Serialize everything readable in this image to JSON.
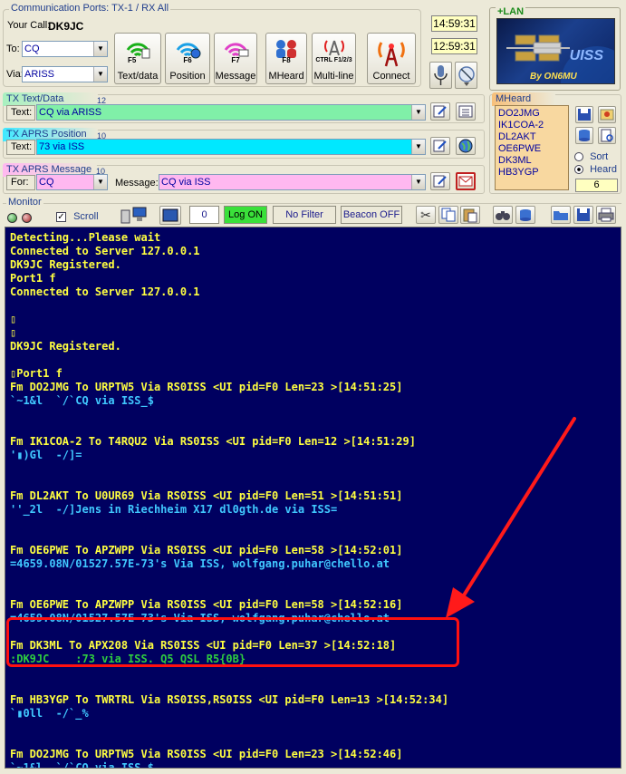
{
  "comm_ports": {
    "title": "Communication Ports: TX-1 / RX All",
    "your_call_label": "Your Call:",
    "your_call": "DK9JC",
    "to_label": "To:",
    "to_value": "CQ",
    "via_label": "Via:",
    "via_value": "ARISS"
  },
  "buttons": {
    "text_data": {
      "key": "F5",
      "label": "Text/data"
    },
    "position": {
      "key": "F6",
      "label": "Position"
    },
    "message": {
      "key": "F7",
      "label": "Message"
    },
    "mheard": {
      "key": "F8",
      "label": "MHeard"
    },
    "multiline": {
      "key": "CTRL F1/2/3",
      "label": "Multi-line"
    },
    "connect": {
      "label": "Connect"
    }
  },
  "clock": {
    "time1": "14:59:31",
    "time2": "12:59:31"
  },
  "lan": {
    "title": "+LAN",
    "logo_text": "UISS",
    "logo_sub": "By ON6MU"
  },
  "tx_text": {
    "title": "TX Text/Data",
    "count": "12",
    "label": "Text:",
    "value": "CQ via ARISS"
  },
  "tx_aprs_pos": {
    "title": "TX APRS Position",
    "count": "10",
    "label": "Text:",
    "value": "73 via ISS"
  },
  "tx_aprs_msg": {
    "title": "TX APRS Message",
    "count": "10",
    "for_label": "For:",
    "for_value": "CQ",
    "msg_label": "Message:",
    "msg_value": "CQ via ISS"
  },
  "mheard": {
    "title": "MHeard",
    "items": [
      "DO2JMG",
      "IK1COA-2",
      "DL2AKT",
      "OE6PWE",
      "DK3ML",
      "HB3YGP"
    ],
    "sort_label": "Sort",
    "heard_label": "Heard",
    "count": "6"
  },
  "monitor": {
    "title": "Monitor",
    "scroll_label": "Scroll",
    "counter": "0",
    "log_btn": "Log ON",
    "filter_btn": "No Filter",
    "beacon_btn": "Beacon OFF",
    "lines": [
      {
        "t": "Detecting...Please wait",
        "c": "yellow"
      },
      {
        "t": "Connected to Server 127.0.0.1",
        "c": "yellow"
      },
      {
        "t": "DK9JC Registered.",
        "c": "yellow"
      },
      {
        "t": "Port1 f",
        "c": "yellow"
      },
      {
        "t": "Connected to Server 127.0.0.1",
        "c": "yellow"
      },
      {
        "t": "",
        "c": "yellow"
      },
      {
        "t": "▯",
        "c": "yellow"
      },
      {
        "t": "▯",
        "c": "yellow"
      },
      {
        "t": "DK9JC Registered.",
        "c": "yellow"
      },
      {
        "t": "",
        "c": "yellow"
      },
      {
        "t": "▯Port1 f",
        "c": "yellow"
      },
      {
        "t": "Fm DO2JMG To URPTW5 Via RS0ISS <UI pid=F0 Len=23 >[14:51:25]",
        "c": "yellow"
      },
      {
        "t": "`~1&l  `/`CQ via ISS_$",
        "c": "cyan"
      },
      {
        "t": "",
        "c": "yellow"
      },
      {
        "t": "",
        "c": "yellow"
      },
      {
        "t": "Fm IK1COA-2 To T4RQU2 Via RS0ISS <UI pid=F0 Len=12 >[14:51:29]",
        "c": "yellow"
      },
      {
        "t": "'▮)Gl  -/]=",
        "c": "cyan"
      },
      {
        "t": "",
        "c": "yellow"
      },
      {
        "t": "",
        "c": "yellow"
      },
      {
        "t": "Fm DL2AKT To U0UR69 Via RS0ISS <UI pid=F0 Len=51 >[14:51:51]",
        "c": "yellow"
      },
      {
        "t": "''_2l  -/]Jens in Riechheim X17 dl0gth.de via ISS=",
        "c": "cyan"
      },
      {
        "t": "",
        "c": "yellow"
      },
      {
        "t": "",
        "c": "yellow"
      },
      {
        "t": "Fm OE6PWE To APZWPP Via RS0ISS <UI pid=F0 Len=58 >[14:52:01]",
        "c": "yellow"
      },
      {
        "t": "=4659.08N/01527.57E-73's Via ISS, wolfgang.puhar@chello.at",
        "c": "cyan"
      },
      {
        "t": "",
        "c": "yellow"
      },
      {
        "t": "",
        "c": "yellow"
      },
      {
        "t": "Fm OE6PWE To APZWPP Via RS0ISS <UI pid=F0 Len=58 >[14:52:16]",
        "c": "yellow"
      },
      {
        "t": "=4659.08N/01527.57E-73's Via ISS, wolfgang.puhar@chello.at",
        "c": "cyan"
      },
      {
        "t": "",
        "c": "yellow"
      },
      {
        "t": "Fm DK3ML To APX208 Via RS0ISS <UI pid=F0 Len=37 >[14:52:18]",
        "c": "yellow"
      },
      {
        "t": ":DK9JC    :73 via ISS. Q5 QSL R5{0B}",
        "c": "green"
      },
      {
        "t": "",
        "c": "yellow"
      },
      {
        "t": "",
        "c": "yellow"
      },
      {
        "t": "Fm HB3YGP To TWRTRL Via RS0ISS,RS0ISS <UI pid=F0 Len=13 >[14:52:34]",
        "c": "yellow"
      },
      {
        "t": "`▮0ll  -/`_%",
        "c": "cyan"
      },
      {
        "t": "",
        "c": "yellow"
      },
      {
        "t": "",
        "c": "yellow"
      },
      {
        "t": "Fm DO2JMG To URPTW5 Via RS0ISS <UI pid=F0 Len=23 >[14:52:46]",
        "c": "yellow"
      },
      {
        "t": "`~1&l  `/`CQ via ISS_$",
        "c": "cyan"
      }
    ]
  },
  "colors": {
    "monitor_bg": "#000060",
    "header_yellow": "#ffff40",
    "payload_cyan": "#40c8ff",
    "payload_green": "#2ecc40",
    "highlight_red": "#ff1010",
    "text_field_green": "#80f0a8",
    "position_field_cyan": "#00e8ff",
    "message_field_pink": "#ffb8f0"
  }
}
